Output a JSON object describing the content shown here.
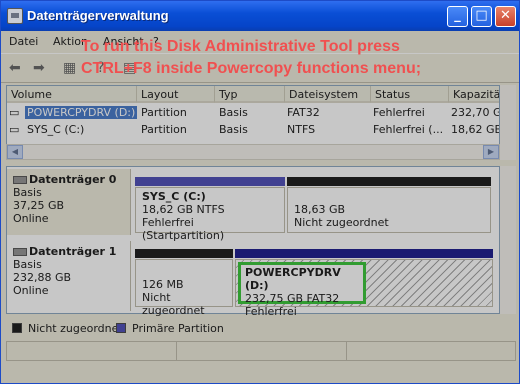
{
  "window": {
    "title": "Datenträgerverwaltung"
  },
  "menu": {
    "file": "Datei",
    "action": "Aktion",
    "view": "Ansicht",
    "extra": "?"
  },
  "overlay": {
    "line1": "To run this Disk Administrative Tool press",
    "line2": "CTRL+F8 inside Powercopy functions menu;"
  },
  "columns": [
    "Volume",
    "Layout",
    "Typ",
    "Dateisystem",
    "Status",
    "Kapazität"
  ],
  "volumes": [
    {
      "name": "POWERCPYDRV (D:)",
      "layout": "Partition",
      "type": "Basis",
      "fs": "FAT32",
      "status": "Fehlerfrei",
      "capacity": "232,70 GB"
    },
    {
      "name": "SYS_C (C:)",
      "layout": "Partition",
      "type": "Basis",
      "fs": "NTFS",
      "status": "Fehlerfrei (...",
      "capacity": "18,62 GB"
    }
  ],
  "disk0": {
    "title": "Datenträger 0",
    "type": "Basis",
    "size": "37,25 GB",
    "state": "Online",
    "p1": {
      "name": "SYS_C  (C:)",
      "detail": "18,62 GB NTFS",
      "status": "Fehlerfrei (Startpartition)"
    },
    "p2": {
      "size": "18,63 GB",
      "status": "Nicht zugeordnet"
    }
  },
  "disk1": {
    "title": "Datenträger 1",
    "type": "Basis",
    "size": "232,88 GB",
    "state": "Online",
    "p1": {
      "size": "126 MB",
      "status": "Nicht zugeordnet"
    },
    "p2": {
      "name": "POWERCPYDRV  (D:)",
      "detail": "232,75 GB FAT32",
      "status": "Fehlerfrei"
    }
  },
  "legend": {
    "unallocated": "Nicht zugeordnet",
    "primary": "Primäre Partition"
  },
  "colors": {
    "primary": "#3a3ab0",
    "unallocated": "#000000",
    "selection": "#22c022"
  },
  "icons": {
    "back": "arrow-left-icon",
    "forward": "arrow-right-icon",
    "minimize": "minimize-icon",
    "maximize": "maximize-icon",
    "close": "close-icon"
  }
}
